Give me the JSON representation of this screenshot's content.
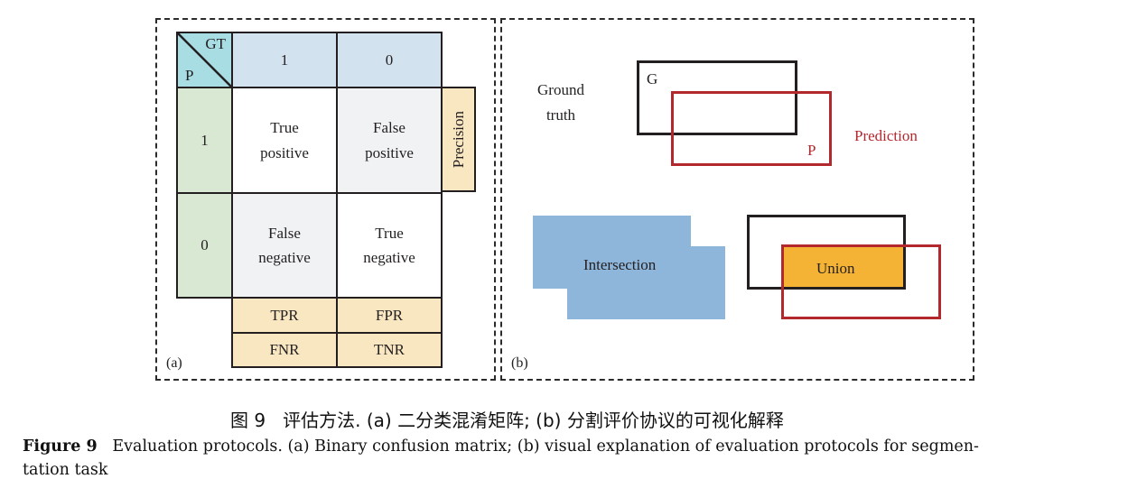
{
  "colors": {
    "header_blue": "#d2e3ef",
    "corner_teal": "#a8dde3",
    "row_green": "#d9e8d3",
    "tan": "#f9e7c2",
    "grey_cell": "#f1f2f4",
    "intersection_blue": "#8db6da",
    "union_orange": "#f5b335",
    "prediction_red": "#b3282d",
    "ground_black": "#231f20"
  },
  "panel_a": {
    "label": "(a)",
    "corner": {
      "top": "GT",
      "bottom": "P"
    },
    "col_headers": [
      "1",
      "0"
    ],
    "row_headers": [
      "1",
      "0"
    ],
    "cells": [
      [
        "True\npositive",
        "False\npositive"
      ],
      [
        "False\nnegative",
        "True\nnegative"
      ]
    ],
    "cell_lines": {
      "tp": [
        "True",
        "positive"
      ],
      "fp": [
        "False",
        "positive"
      ],
      "fn": [
        "False",
        "negative"
      ],
      "tn": [
        "True",
        "negative"
      ]
    },
    "precision": "Precision",
    "rates": [
      [
        "TPR",
        "FPR"
      ],
      [
        "FNR",
        "TNR"
      ]
    ]
  },
  "panel_b": {
    "label": "(b)",
    "ground_truth_label": [
      "Ground",
      "truth"
    ],
    "g_label": "G",
    "p_label": "P",
    "prediction_label": "Prediction",
    "intersection_label": "Intersection",
    "union_label": "Union"
  },
  "caption": {
    "cn": "图 9   评估方法. (a) 二分类混淆矩阵; (b) 分割评价协议的可视化解释",
    "en_bold": "Figure 9",
    "en_line1": "Evaluation protocols. (a) Binary confusion matrix; (b) visual explanation of evaluation protocols for segmen-",
    "en_line2": "tation task"
  }
}
